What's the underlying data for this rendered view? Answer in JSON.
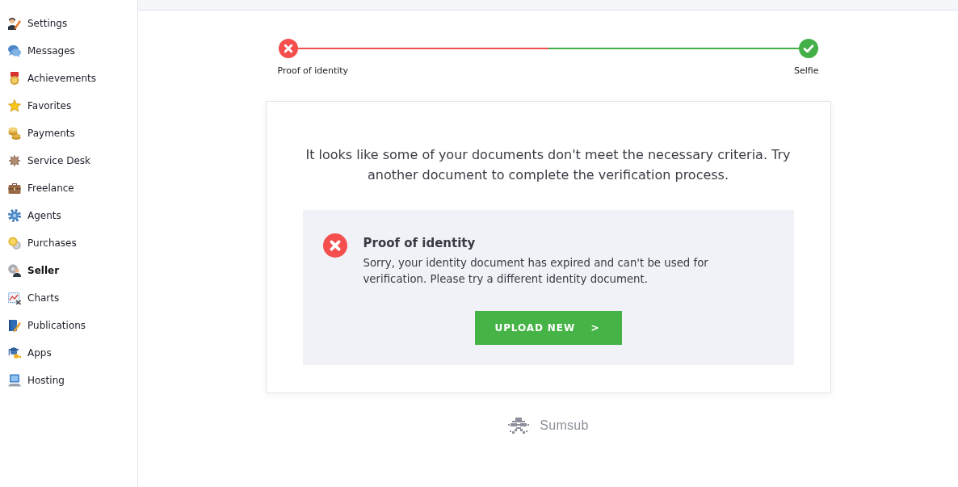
{
  "sidebar": {
    "items": [
      {
        "label": "Settings",
        "selected": false
      },
      {
        "label": "Messages",
        "selected": false
      },
      {
        "label": "Achievements",
        "selected": false
      },
      {
        "label": "Favorites",
        "selected": false
      },
      {
        "label": "Payments",
        "selected": false
      },
      {
        "label": "Service Desk",
        "selected": false
      },
      {
        "label": "Freelance",
        "selected": false
      },
      {
        "label": "Agents",
        "selected": false
      },
      {
        "label": "Purchases",
        "selected": false
      },
      {
        "label": "Seller",
        "selected": true
      },
      {
        "label": "Charts",
        "selected": false
      },
      {
        "label": "Publications",
        "selected": false
      },
      {
        "label": "Apps",
        "selected": false
      },
      {
        "label": "Hosting",
        "selected": false
      }
    ]
  },
  "stepper": {
    "steps": [
      {
        "label": "Proof of identity",
        "approved": false
      },
      {
        "label": "Selfie",
        "approved": true
      }
    ]
  },
  "card": {
    "message": "It looks like some of your documents don't meet the necessary criteria. Try another document to complete the verification process.",
    "review": {
      "approved": false,
      "title": "Proof of identity",
      "text": "Sorry, your identity document has expired and can't be used for verification. Please try a different identity document."
    },
    "button": {
      "label": "UPLOAD NEW",
      "arrow": ">"
    }
  },
  "footer": {
    "brand": "Sumsub"
  }
}
